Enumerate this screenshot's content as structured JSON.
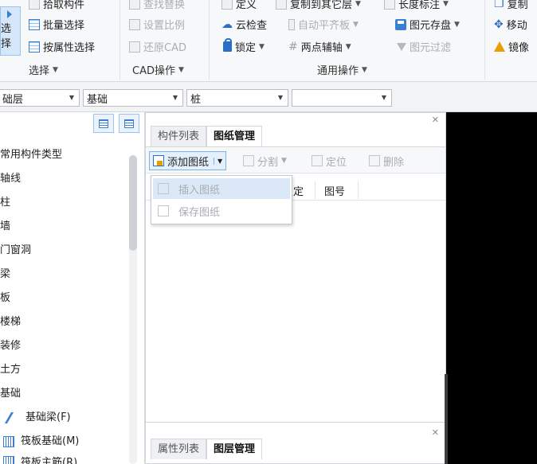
{
  "ribbon": {
    "select_label": "选择",
    "select_group": {
      "pick_component": "拾取构件",
      "batch_select": "批量选择",
      "select_by_attr": "按属性选择",
      "group_label": "选择"
    },
    "cad_group": {
      "find_replace": "查找替换",
      "set_ratio": "设置比例",
      "restore_cad": "还原CAD",
      "group_label": "CAD操作"
    },
    "common_group": {
      "define": "定义",
      "copy_to_layer": "复制到其它层",
      "cloud_check": "云检查",
      "auto_flatten": "自动平齐板",
      "lock": "锁定",
      "two_point_axis": "两点辅轴",
      "length_mark": "长度标注",
      "save_element": "图元存盘",
      "element_filter": "图元过滤",
      "group_label": "通用操作"
    },
    "edit_group": {
      "copy": "复制",
      "move": "移动",
      "mirror": "镜像"
    }
  },
  "filterbar": {
    "floor": "础层",
    "category": "基础",
    "component": "桩",
    "sub": ""
  },
  "tree": {
    "items": [
      "常用构件类型",
      "轴线",
      "柱",
      "墙",
      "门窗洞",
      "梁",
      "板",
      "楼梯",
      "装修",
      "土方",
      "基础",
      "基础梁(F)",
      "筏板基础(M)",
      "筏板主筋(R)"
    ]
  },
  "drawing_panel": {
    "tabs": [
      "构件列表",
      "图纸管理"
    ],
    "toolbar": {
      "add_drawing": "添加图纸",
      "split": "分割",
      "locate": "定位",
      "delete": "删除"
    },
    "columns": [
      "锁定",
      "图号"
    ],
    "menu": {
      "insert_drawing": "插入图纸",
      "save_drawing": "保存图纸"
    }
  },
  "property_panel": {
    "tabs": [
      "属性列表",
      "图层管理"
    ]
  }
}
